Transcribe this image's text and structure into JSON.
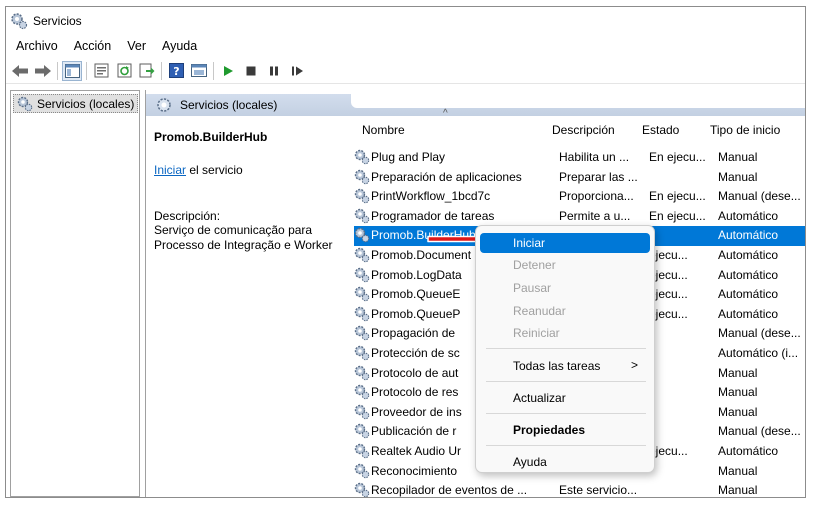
{
  "window": {
    "title": "Servicios"
  },
  "menu": [
    "Archivo",
    "Acción",
    "Ver",
    "Ayuda"
  ],
  "toolbar_icons": [
    "back-icon",
    "forward-icon",
    "show-tree-icon",
    "properties-icon",
    "refresh-icon",
    "export-icon",
    "help-icon",
    "console-icon",
    "start-icon",
    "stop-icon",
    "pause-icon",
    "resume-icon"
  ],
  "tree": {
    "root_label": "Servicios (locales)"
  },
  "section": {
    "header": "Servicios (locales)"
  },
  "detail": {
    "service_name": "Promob.BuilderHub",
    "start_link": "Iniciar",
    "start_suffix": " el servicio",
    "description_label": "Descripción:",
    "description_text": "Serviço de comunicação para Processo de Integração e Worker"
  },
  "columns": {
    "sort_caret": "^",
    "name": "Nombre",
    "description": "Descripción",
    "state": "Estado",
    "startup": "Tipo de inicio"
  },
  "services": [
    {
      "name": "Plug and Play",
      "description": "Habilita un ...",
      "state": "En ejecu...",
      "startup": "Manual"
    },
    {
      "name": "Preparación de aplicaciones",
      "description": "Preparar las ...",
      "state": "",
      "startup": "Manual"
    },
    {
      "name": "PrintWorkflow_1bcd7c",
      "description": "Proporciona...",
      "state": "En ejecu...",
      "startup": "Manual (dese..."
    },
    {
      "name": "Programador de tareas",
      "description": "Permite a u...",
      "state": "En ejecu...",
      "startup": "Automático"
    },
    {
      "name": "Promob.BuilderHub",
      "description": "",
      "state": "",
      "startup": "Automático"
    },
    {
      "name": "Promob.Document",
      "description": "",
      "state": "ejecu...",
      "startup": "Automático"
    },
    {
      "name": "Promob.LogData",
      "description": "",
      "state": "ejecu...",
      "startup": "Automático"
    },
    {
      "name": "Promob.QueueE",
      "description": "",
      "state": "ejecu...",
      "startup": "Automático"
    },
    {
      "name": "Promob.QueueP",
      "description": "",
      "state": "ejecu...",
      "startup": "Automático"
    },
    {
      "name": "Propagación de",
      "description": "",
      "state": "",
      "startup": "Manual (dese..."
    },
    {
      "name": "Protección de sc",
      "description": "",
      "state": "",
      "startup": "Automático (i..."
    },
    {
      "name": "Protocolo de aut",
      "description": "",
      "state": "",
      "startup": "Manual"
    },
    {
      "name": "Protocolo de res",
      "description": "",
      "state": "",
      "startup": "Manual"
    },
    {
      "name": "Proveedor de ins",
      "description": "",
      "state": "",
      "startup": "Manual"
    },
    {
      "name": "Publicación de r",
      "description": "",
      "state": "",
      "startup": "Manual (dese..."
    },
    {
      "name": "Realtek Audio Ur",
      "description": "",
      "state": "ejecu...",
      "startup": "Automático"
    },
    {
      "name": "Reconocimiento",
      "description": "",
      "state": "",
      "startup": "Manual"
    },
    {
      "name": "Recopilador de eventos de ...",
      "description": "Este servicio...",
      "state": "",
      "startup": "Manual"
    }
  ],
  "context_menu": {
    "start": "Iniciar",
    "stop": "Detener",
    "pause": "Pausar",
    "resume": "Reanudar",
    "restart": "Reiniciar",
    "all_tasks": "Todas las tareas",
    "all_tasks_arrow": ">",
    "refresh": "Actualizar",
    "properties": "Propiedades",
    "help": "Ayuda"
  },
  "colors": {
    "selection": "#0078d7",
    "annotation_arrow": "#e01818",
    "header_band": "#c9d5e6"
  }
}
